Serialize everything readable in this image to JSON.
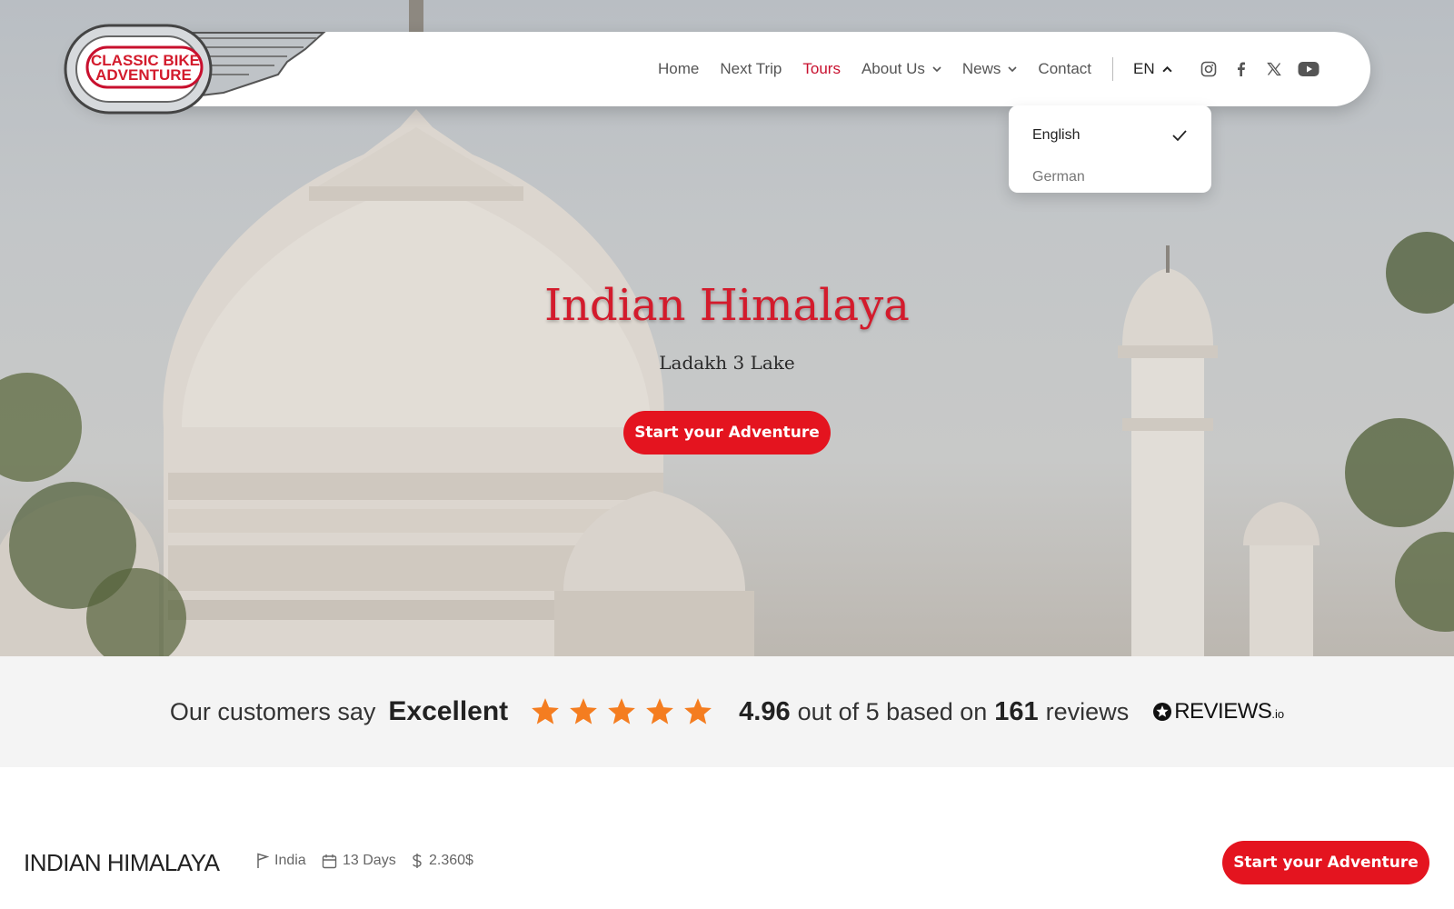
{
  "brand": {
    "logo_line1": "CLASSIC BIKE",
    "logo_line2": "ADVENTURE",
    "red": "#d31b2c"
  },
  "nav": {
    "items": [
      {
        "label": "Home"
      },
      {
        "label": "Next Trip"
      },
      {
        "label": "Tours",
        "active": true
      },
      {
        "label": "About Us",
        "dropdown": true
      },
      {
        "label": "News",
        "dropdown": true
      },
      {
        "label": "Contact"
      }
    ],
    "language": "EN",
    "social_icons": [
      "instagram-icon",
      "facebook-icon",
      "x-twitter-icon",
      "youtube-icon"
    ]
  },
  "language_menu": {
    "options": [
      {
        "label": "English",
        "selected": true
      },
      {
        "label": "German",
        "selected": false
      }
    ]
  },
  "hero": {
    "title": "Indian Himalaya",
    "subtitle": "Ladakh 3 Lake",
    "cta": "Start your Adventure"
  },
  "reviews": {
    "intro": "Our customers say",
    "rating_word": "Excellent",
    "stars": 5,
    "score": "4.96",
    "out_of": "out of 5 based on",
    "count": "161",
    "count_word": "reviews",
    "provider": "REVIEWS",
    "provider_suffix": ".io",
    "star_color": "#f47d20"
  },
  "tour": {
    "title": "INDIAN HIMALAYA",
    "country": "India",
    "duration": "13 Days",
    "price": "2.360$",
    "cta": "Start your Adventure"
  }
}
